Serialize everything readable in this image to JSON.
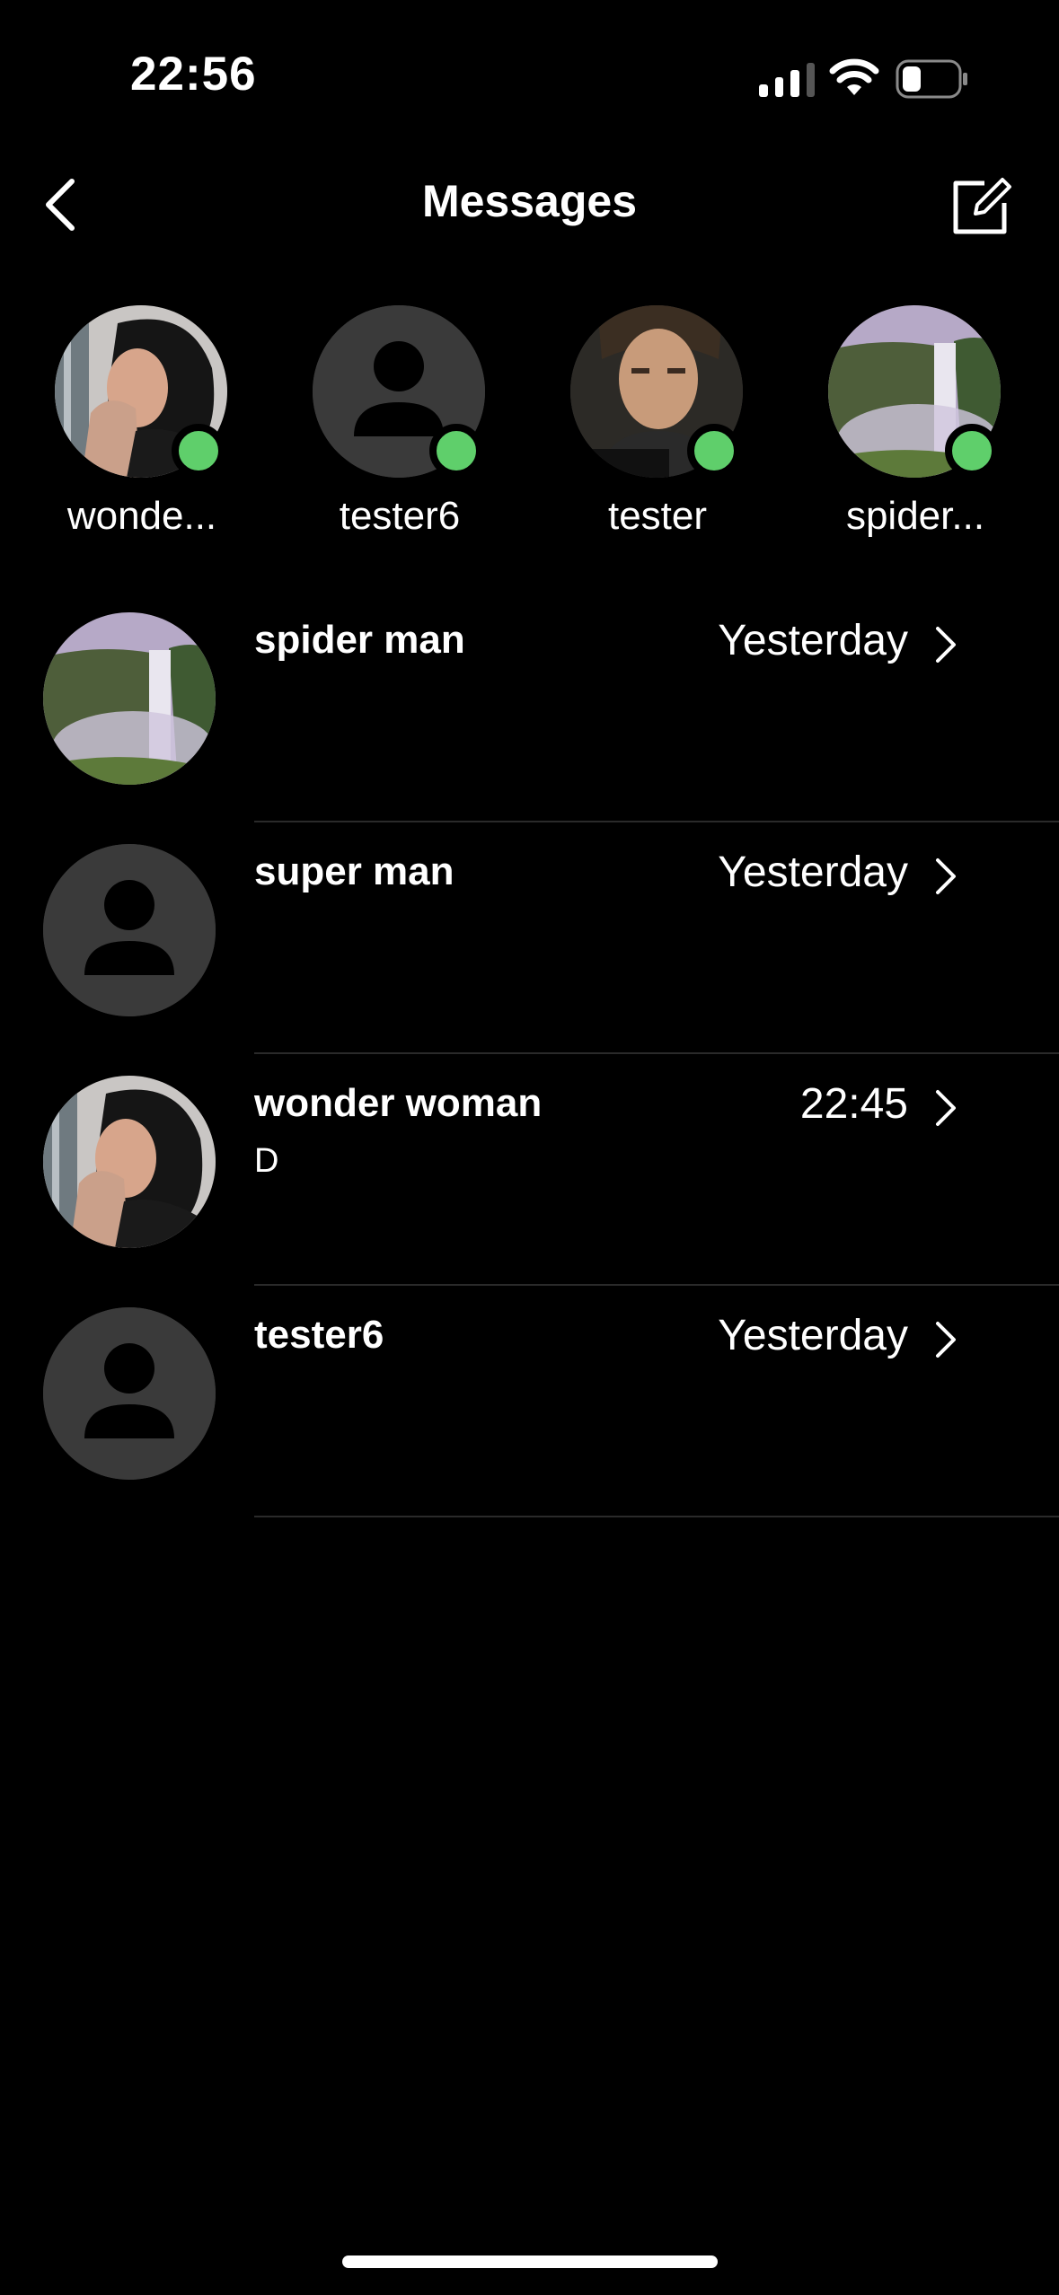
{
  "status_bar": {
    "time": "22:56"
  },
  "nav": {
    "title": "Messages"
  },
  "stories": [
    {
      "name": "wonde...",
      "avatar": "photo-woman",
      "online": true
    },
    {
      "name": "tester6",
      "avatar": "default-person",
      "online": true
    },
    {
      "name": "tester",
      "avatar": "photo-man",
      "online": true
    },
    {
      "name": "spider...",
      "avatar": "photo-waterfall",
      "online": true
    }
  ],
  "conversations": [
    {
      "name": "spider man",
      "time": "Yesterday",
      "preview": "",
      "avatar": "photo-waterfall"
    },
    {
      "name": "super man",
      "time": "Yesterday",
      "preview": "",
      "avatar": "default-person"
    },
    {
      "name": "wonder woman",
      "time": "22:45",
      "preview": "D",
      "avatar": "photo-woman"
    },
    {
      "name": "tester6",
      "time": "Yesterday",
      "preview": "",
      "avatar": "default-person"
    }
  ],
  "colors": {
    "background": "#000000",
    "online": "#5fcf6b",
    "avatar_placeholder": "#3a3a3a",
    "divider": "#2a2a2a"
  }
}
